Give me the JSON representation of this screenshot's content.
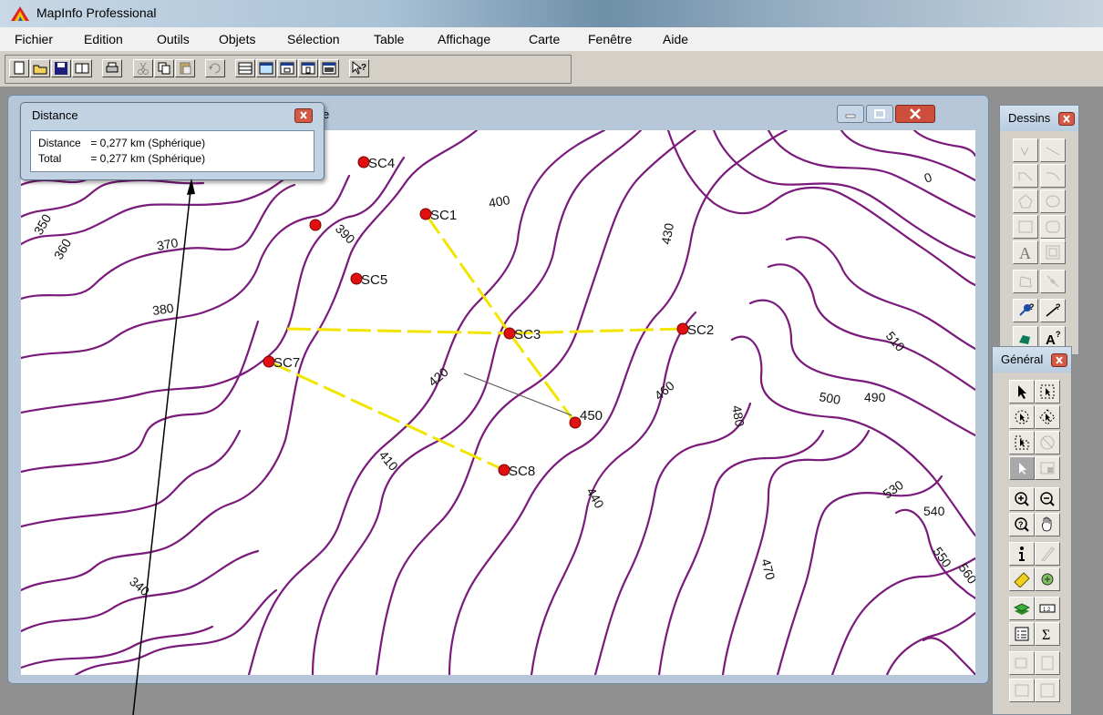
{
  "app": {
    "title": "MapInfo Professional"
  },
  "menu": [
    "Fichier",
    "Edition",
    "Outils",
    "Objets",
    "Sélection",
    "Table",
    "Affichage",
    "Carte",
    "Fenêtre",
    "Aide"
  ],
  "map_window": {
    "title_tail": "e"
  },
  "distance_window": {
    "title": "Distance",
    "rows": [
      {
        "label": "Distance",
        "value": "= 0,277 km (Sphérique)"
      },
      {
        "label": "Total",
        "value": "= 0,277 km (Sphérique)"
      }
    ]
  },
  "palettes": {
    "dessins": {
      "title": "Dessins"
    },
    "general": {
      "title": "Général"
    }
  },
  "points": [
    {
      "label": "SC4"
    },
    {
      "label": "SC1"
    },
    {
      "label": "SC5"
    },
    {
      "label": "SC3"
    },
    {
      "label": "SC2"
    },
    {
      "label": "SC7"
    },
    {
      "label": "SC8"
    },
    {
      "label": "450"
    }
  ],
  "contour_labels": [
    "370",
    "380",
    "390",
    "400",
    "410",
    "420",
    "430",
    "440",
    "460",
    "470",
    "480",
    "490",
    "500",
    "510",
    "530",
    "540",
    "340",
    "350",
    "360",
    "0",
    "550",
    "560"
  ],
  "colors": {
    "contour": "#7a1a7a",
    "points": "#e01010",
    "lines": "#f2e600",
    "titlebar": "#b5c7d9"
  }
}
